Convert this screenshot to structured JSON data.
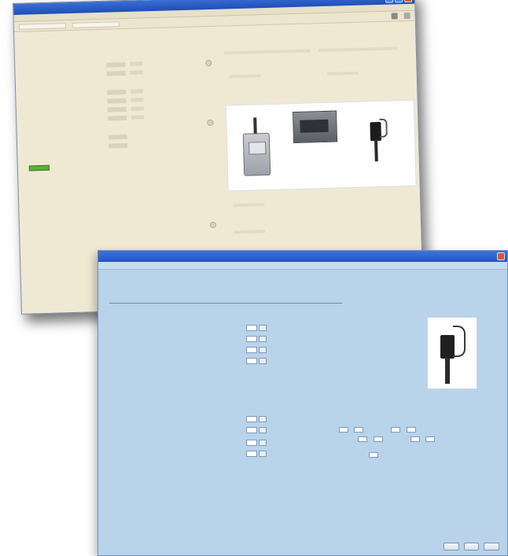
{
  "back_window": {
    "title": "",
    "menu": [
      "",
      "",
      "",
      "",
      ""
    ],
    "toolbar": {
      "fields": [
        "",
        ""
      ]
    },
    "sections": [
      {
        "name": "",
        "rows": 1
      },
      {
        "name": "",
        "rows": 2
      },
      {
        "name": "",
        "rows": 4
      },
      {
        "name": "",
        "rows": 2
      },
      {
        "name": "",
        "rows": 0
      }
    ],
    "status_button_color": "#5fae3a"
  },
  "front_window": {
    "title": "",
    "tab": "",
    "heading": "",
    "subheading": "",
    "section1": {
      "title": "",
      "rows": [
        "",
        "",
        "",
        ""
      ],
      "note": ""
    },
    "section2": {
      "title": "",
      "rows": [
        "",
        "",
        "",
        ""
      ]
    },
    "buttons": [
      "",
      "",
      ""
    ]
  },
  "colors": {
    "titlebar_blue": "#2255c2",
    "front_bg": "#b9d3ea",
    "back_bg": "#efe9d4",
    "close_button": "#d9542b"
  }
}
